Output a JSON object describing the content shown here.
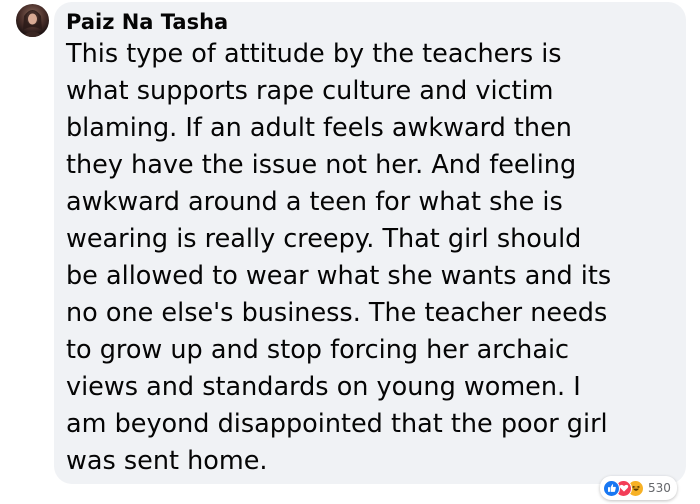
{
  "comment": {
    "author": "Paiz Na Tasha",
    "text": "This type of attitude by the teachers is\nwhat supports rape culture and victim\nblaming. If an adult feels awkward then\nthey have the issue not her. And feeling\nawkward around a teen for what she is\nwearing is really creepy. That girl should\nbe allowed to wear what she wants and its\nno one else's business. The teacher needs\nto grow up and stop forcing her archaic\nviews and standards on young women. I\nam beyond disappointed that the poor girl\nwas sent home.",
    "reactions": {
      "icons": [
        "like-icon",
        "love-icon",
        "haha-icon"
      ],
      "count": "530"
    }
  },
  "colors": {
    "bubble_background": "#f0f2f5",
    "text": "#050505",
    "like": "#1877f2",
    "love": "#f33e58",
    "haha": "#f7b125",
    "count_text": "#65676b"
  }
}
